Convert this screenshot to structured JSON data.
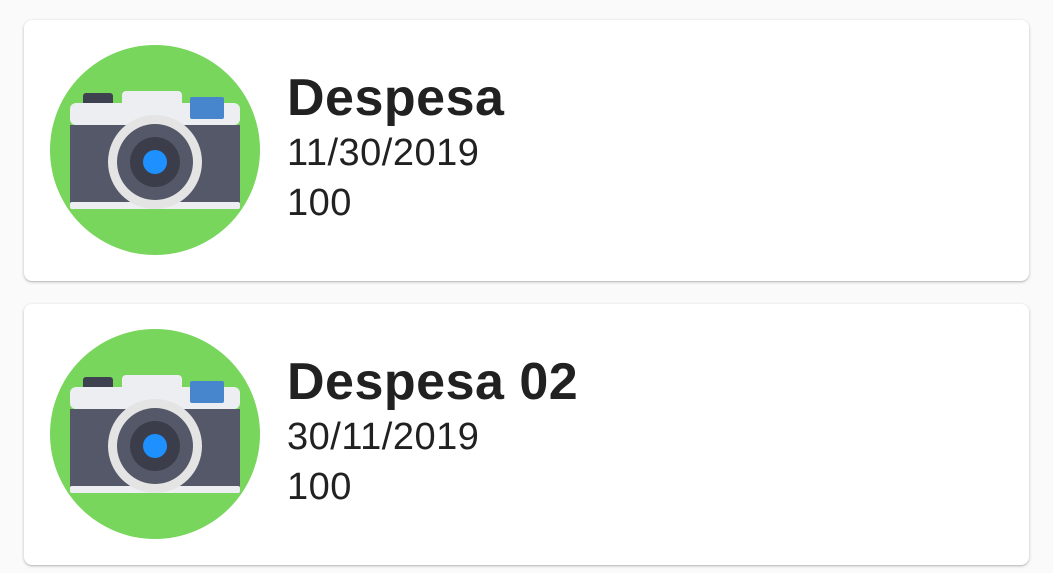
{
  "expenses": [
    {
      "title": "Despesa",
      "date": "11/30/2019",
      "amount": "100",
      "icon": "camera-icon"
    },
    {
      "title": "Despesa 02",
      "date": "30/11/2019",
      "amount": "100",
      "icon": "camera-icon"
    }
  ],
  "colors": {
    "avatar_bg": "#77D65B",
    "camera_body": "#545868",
    "camera_top": "#EDEEF2",
    "lens_ring": "#E4E4E4",
    "lens_inner": "#3B3E4A",
    "lens_center": "#1E90FF",
    "flash": "#4786CD"
  }
}
